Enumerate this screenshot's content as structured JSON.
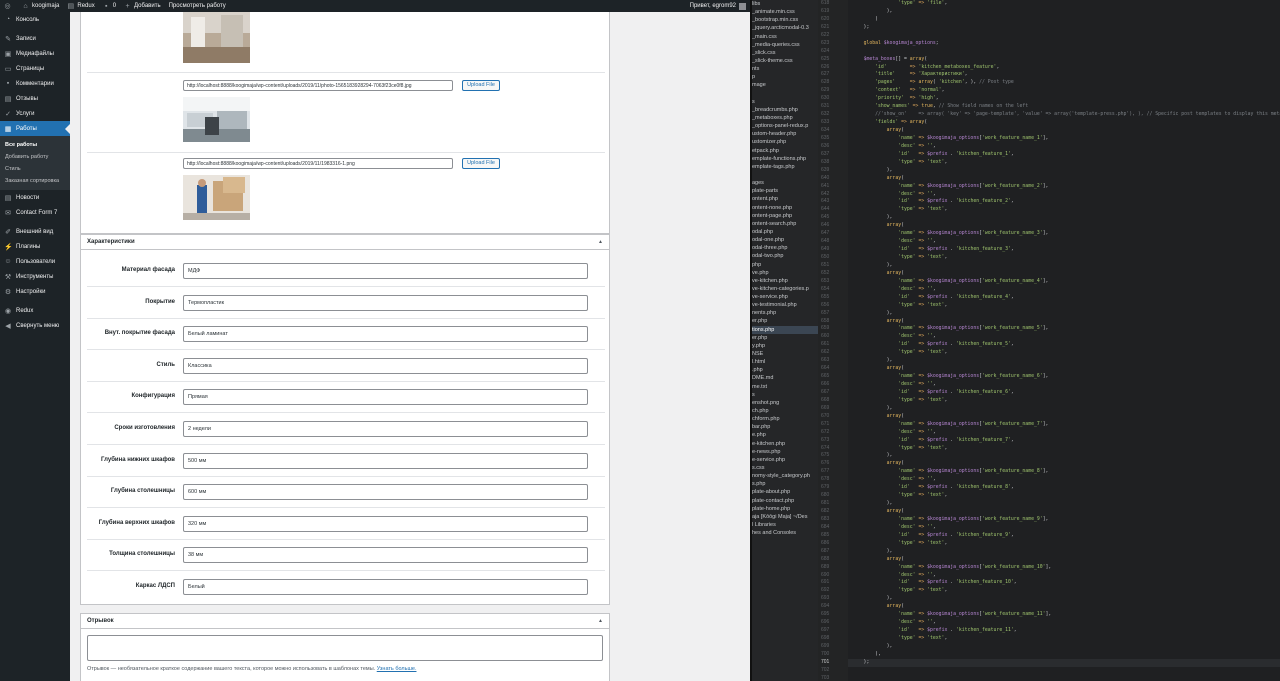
{
  "adminbar": {
    "site_name": "koogimaja",
    "redux": "Redux",
    "comments_count": "0",
    "add_new": "Добавить",
    "view_work": "Просмотреть работу",
    "greeting": "Привет, egrom92"
  },
  "menu": {
    "items": [
      {
        "label": "Консоль",
        "icon": "dashboard-icon"
      },
      {
        "label": "Записи",
        "icon": "pin-icon"
      },
      {
        "label": "Медиафайлы",
        "icon": "media-icon"
      },
      {
        "label": "Страницы",
        "icon": "page-icon"
      },
      {
        "label": "Комментарии",
        "icon": "comment-icon"
      },
      {
        "label": "Отзывы",
        "icon": "reviews-icon"
      },
      {
        "label": "Услуги",
        "icon": "services-icon"
      },
      {
        "label": "Работы",
        "icon": "portfolio-icon"
      }
    ],
    "submenu": [
      "Все работы",
      "Добавить работу",
      "Стиль",
      "Заказная сортировка"
    ],
    "items2": [
      {
        "label": "Новости",
        "icon": "news-icon"
      },
      {
        "label": "Contact Form 7",
        "icon": "mail-icon"
      },
      {
        "label": "Внешний вид",
        "icon": "appearance-icon"
      },
      {
        "label": "Плагины",
        "icon": "plugin-icon"
      },
      {
        "label": "Пользователи",
        "icon": "users-icon"
      },
      {
        "label": "Инструменты",
        "icon": "tools-icon"
      },
      {
        "label": "Настройки",
        "icon": "settings-icon"
      },
      {
        "label": "Redux",
        "icon": "redux-icon"
      },
      {
        "label": "Свернуть меню",
        "icon": "collapse-icon"
      }
    ]
  },
  "gallery": {
    "rows": [
      {
        "url": "http://localhost:8888/koogimaja/wp-content/uploads/2019/11/photo-1565183928294-7063f23ce0f8.jpg",
        "button": "Upload File"
      },
      {
        "url": "http://localhost:8888/koogimaja/wp-content/uploads/2019/11/1983316-1.png",
        "button": "Upload File"
      }
    ]
  },
  "characteristics": {
    "title": "Характеристики",
    "fields": [
      {
        "label": "Материал фасада",
        "value": "МДФ"
      },
      {
        "label": "Покрытие",
        "value": "Термопластик"
      },
      {
        "label": "Внут. покрытие фасада",
        "value": "Белый ламинат"
      },
      {
        "label": "Стиль",
        "value": "Классика"
      },
      {
        "label": "Конфигурация",
        "value": "Прямая"
      },
      {
        "label": "Сроки изготовления",
        "value": "2 недели"
      },
      {
        "label": "Глубина нижних шкафов",
        "value": "500 мм"
      },
      {
        "label": "Глубина столешницы",
        "value": "600 мм"
      },
      {
        "label": "Глубина верхних шкафов",
        "value": "320 мм"
      },
      {
        "label": "Толщина столешницы",
        "value": "38 мм"
      },
      {
        "label": "Каркас ЛДСП",
        "value": "Белый"
      }
    ]
  },
  "excerpt": {
    "title": "Отрывок",
    "help": "Отрывок — необязательное краткое содержание вашего текста, которое можно использовать в шаблонах темы.",
    "link": "Узнать больше."
  },
  "tree": [
    "libs",
    "_animate.min.css",
    "_bootstrap.min.css",
    "_jquery.arcticmodal-0.3",
    "_main.css",
    "_media-queries.css",
    "_slick.css",
    "_slick-theme.css",
    "nts",
    "p",
    "mage",
    "",
    "s",
    "_breadcrumbs.php",
    "_metaboxes.php",
    "_options-panel-redux.p",
    "ustom-header.php",
    "ustomizer.php",
    "etpack.php",
    "emplate-functions.php",
    "emplate-tags.php",
    "",
    "ages",
    "plate-parts",
    "ontent.php",
    "ontent-none.php",
    "ontent-page.php",
    "ontent-search.php",
    "odal.php",
    "odal-one.php",
    "odal-three.php",
    "odal-two.php",
    "php",
    "ve.php",
    "ve-kitchen.php",
    "ve-kitchen-categories.p",
    "ve-service.php",
    "ve-testimonial.php",
    "nents.php",
    "er.php",
    "tions.php",
    "er.php",
    "y.php",
    "NSE",
    "l.html",
    ".php",
    "DME.md",
    "me.txt",
    "s",
    "enshot.png",
    "ch.php",
    "chform.php",
    "bar.php",
    "e.php",
    "e-kitchen.php",
    "e-news.php",
    "e-service.php",
    "s.css",
    "nomy-style_category.ph",
    "s.php",
    "plate-about.php",
    "plate-contact.php",
    "plate-home.php",
    "aja [Kōōgi Maja] ~/Des",
    "l Libraries",
    "hes and Consoles"
  ],
  "editor": {
    "line_numbers": [
      "618",
      "619",
      "620",
      "621",
      "622",
      "623",
      "624",
      "625",
      "626",
      "627",
      "628",
      "629",
      "630",
      "631",
      "632",
      "633",
      "634",
      "635",
      "636",
      "637",
      "638",
      "639",
      "640",
      "641",
      "642",
      "643",
      "644",
      "645",
      "646",
      "647",
      "648",
      "649",
      "650",
      "651",
      "652",
      "653",
      "654",
      "655",
      "656",
      "657",
      "658",
      "659",
      "660",
      "661",
      "662",
      "663",
      "664",
      "665",
      "666",
      "667",
      "668",
      "669",
      "670",
      "671",
      "672",
      "673",
      "674",
      "675",
      "676",
      "677",
      "678",
      "679",
      "680",
      "681",
      "682",
      "683",
      "684",
      "685",
      "686",
      "687",
      "688",
      "689",
      "690",
      "691",
      "692",
      "693",
      "694",
      "695",
      "696",
      "697",
      "698",
      "699",
      "700",
      "701",
      "702",
      "703"
    ],
    "current_line": "701",
    "lines": [
      "                'type' => 'file',",
      "            ),",
      "        )",
      "    );",
      "",
      "    global $koogimaja_options;",
      "",
      "    $meta_boxes[] = array(",
      "        'id'        => 'kitchen_metaboxes_feature',",
      "        'title'     => 'Характеристики',",
      "        'pages'     => array( 'kitchen', ), // Post type",
      "        'context'   => 'normal',",
      "        'priority'  => 'high',",
      "        'show_names' => true, // Show field names on the left",
      "        //'show_on'    => array( 'key' => 'page-template', 'value' => array('template-press.php'), ), // Specific post templates to display this metabox",
      "        'fields' => array(",
      "            array(",
      "                'name' => $koogimaja_options['work_feature_name_1'],",
      "                'desc' => '',",
      "                'id'   => $prefix . 'kitchen_feature_1',",
      "                'type' => 'text',",
      "            ),",
      "            array(",
      "                'name' => $koogimaja_options['work_feature_name_2'],",
      "                'desc' => '',",
      "                'id'   => $prefix . 'kitchen_feature_2',",
      "                'type' => 'text',",
      "            ),",
      "            array(",
      "                'name' => $koogimaja_options['work_feature_name_3'],",
      "                'desc' => '',",
      "                'id'   => $prefix . 'kitchen_feature_3',",
      "                'type' => 'text',",
      "            ),",
      "            array(",
      "                'name' => $koogimaja_options['work_feature_name_4'],",
      "                'desc' => '',",
      "                'id'   => $prefix . 'kitchen_feature_4',",
      "                'type' => 'text',",
      "            ),",
      "            array(",
      "                'name' => $koogimaja_options['work_feature_name_5'],",
      "                'desc' => '',",
      "                'id'   => $prefix . 'kitchen_feature_5',",
      "                'type' => 'text',",
      "            ),",
      "            array(",
      "                'name' => $koogimaja_options['work_feature_name_6'],",
      "                'desc' => '',",
      "                'id'   => $prefix . 'kitchen_feature_6',",
      "                'type' => 'text',",
      "            ),",
      "            array(",
      "                'name' => $koogimaja_options['work_feature_name_7'],",
      "                'desc' => '',",
      "                'id'   => $prefix . 'kitchen_feature_7',",
      "                'type' => 'text',",
      "            ),",
      "            array(",
      "                'name' => $koogimaja_options['work_feature_name_8'],",
      "                'desc' => '',",
      "                'id'   => $prefix . 'kitchen_feature_8',",
      "                'type' => 'text',",
      "            ),",
      "            array(",
      "                'name' => $koogimaja_options['work_feature_name_9'],",
      "                'desc' => '',",
      "                'id'   => $prefix . 'kitchen_feature_9',",
      "                'type' => 'text',",
      "            ),",
      "            array(",
      "                'name' => $koogimaja_options['work_feature_name_10'],",
      "                'desc' => '',",
      "                'id'   => $prefix . 'kitchen_feature_10',",
      "                'type' => 'text',",
      "            ),",
      "            array(",
      "                'name' => $koogimaja_options['work_feature_name_11'],",
      "                'desc' => '',",
      "                'id'   => $prefix . 'kitchen_feature_11',",
      "                'type' => 'text',",
      "            ),",
      "        ),",
      "    );",
      "",
      ""
    ]
  }
}
